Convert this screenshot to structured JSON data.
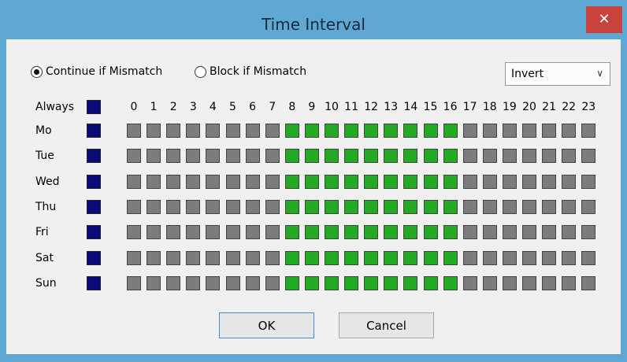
{
  "window": {
    "title": "Time Interval",
    "close_glyph": "✕"
  },
  "mode": {
    "options": [
      {
        "label": "Continue if Mismatch",
        "checked": true
      },
      {
        "label": "Block if Mismatch",
        "checked": false
      }
    ]
  },
  "action_select": {
    "value": "Invert"
  },
  "grid": {
    "always_label": "Always",
    "hours": [
      "0",
      "1",
      "2",
      "3",
      "4",
      "5",
      "6",
      "7",
      "8",
      "9",
      "10",
      "11",
      "12",
      "13",
      "14",
      "15",
      "16",
      "17",
      "18",
      "19",
      "20",
      "21",
      "22",
      "23"
    ],
    "days": [
      {
        "label": "Mo",
        "active_hours": [
          8,
          9,
          10,
          11,
          12,
          13,
          14,
          15,
          16
        ]
      },
      {
        "label": "Tue",
        "active_hours": [
          8,
          9,
          10,
          11,
          12,
          13,
          14,
          15,
          16
        ]
      },
      {
        "label": "Wed",
        "active_hours": [
          8,
          9,
          10,
          11,
          12,
          13,
          14,
          15,
          16
        ]
      },
      {
        "label": "Thu",
        "active_hours": [
          8,
          9,
          10,
          11,
          12,
          13,
          14,
          15,
          16
        ]
      },
      {
        "label": "Fri",
        "active_hours": [
          8,
          9,
          10,
          11,
          12,
          13,
          14,
          15,
          16
        ]
      },
      {
        "label": "Sat",
        "active_hours": [
          8,
          9,
          10,
          11,
          12,
          13,
          14,
          15,
          16
        ]
      },
      {
        "label": "Sun",
        "active_hours": [
          8,
          9,
          10,
          11,
          12,
          13,
          14,
          15,
          16
        ]
      }
    ]
  },
  "colors": {
    "on": "#22aa22",
    "off": "#7c7c7c",
    "day_selector": "#0a0a7a"
  },
  "buttons": {
    "ok": "OK",
    "cancel": "Cancel"
  }
}
